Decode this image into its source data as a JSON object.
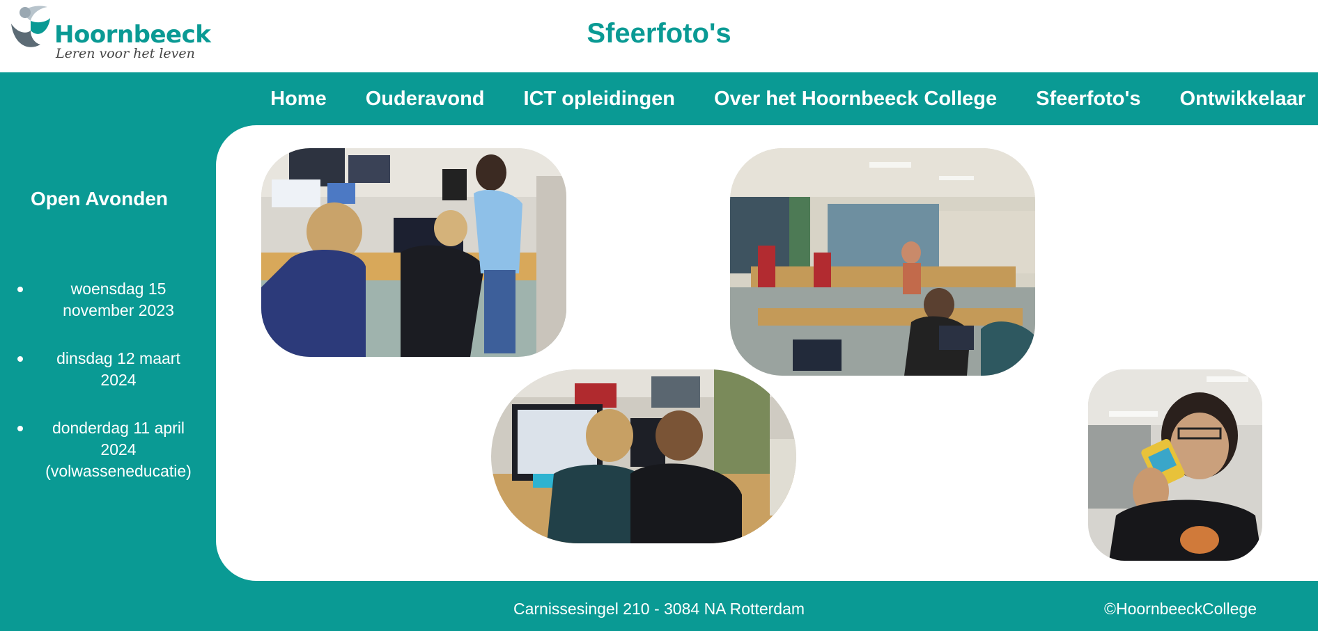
{
  "logo": {
    "name": "Hoornbeeck",
    "tagline": "Leren voor het leven"
  },
  "page": {
    "title": "Sfeerfoto's"
  },
  "nav": {
    "items": [
      {
        "label": "Home"
      },
      {
        "label": "Ouderavond"
      },
      {
        "label": "ICT opleidingen"
      },
      {
        "label": "Over het Hoornbeeck College"
      },
      {
        "label": "Sfeerfoto's"
      },
      {
        "label": "Ontwikkelaar"
      }
    ]
  },
  "sidebar": {
    "title": "Open Avonden",
    "items": [
      {
        "text": "woensdag 15 november 2023"
      },
      {
        "text": "dinsdag 12 maart 2024"
      },
      {
        "text": "donderdag 11 april 2024 (volwasseneducatie)"
      }
    ]
  },
  "footer": {
    "address": "Carnissesingel 210 - 3084 NA Rotterdam",
    "copyright": "©HoornbeeckCollege"
  },
  "colors": {
    "brand": "#0a9a94",
    "background": "#ffffff",
    "text_on_brand": "#ffffff"
  }
}
